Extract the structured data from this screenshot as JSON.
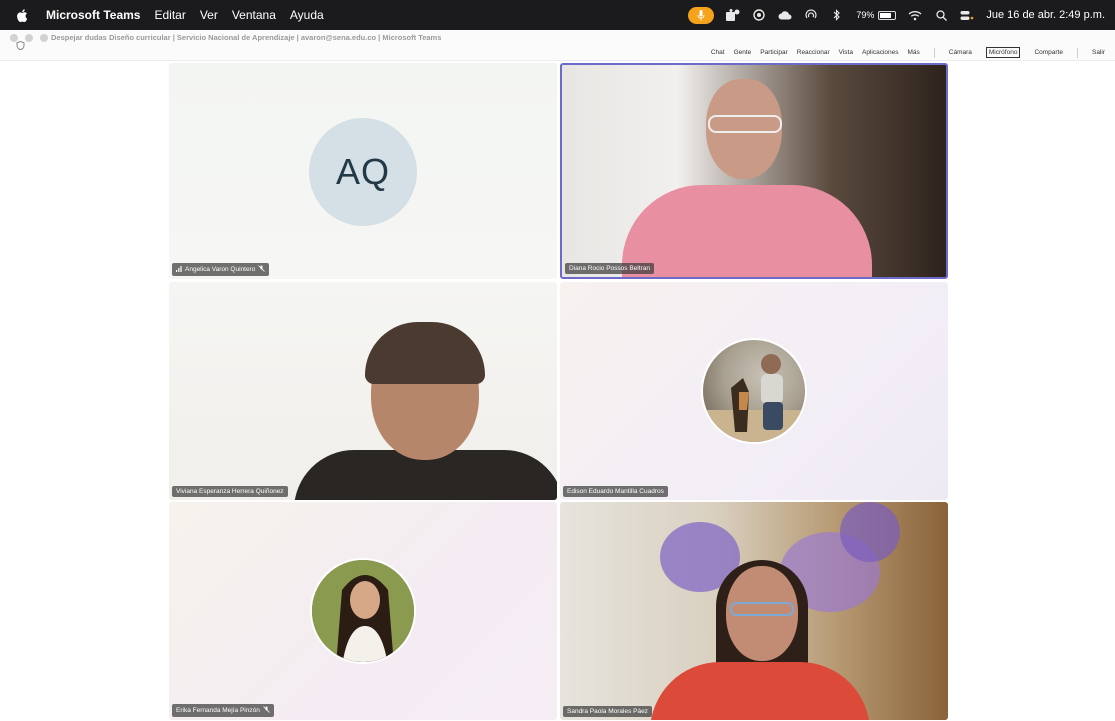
{
  "menubar": {
    "app_name": "Microsoft Teams",
    "items": [
      "Editar",
      "Ver",
      "Ventana",
      "Ayuda"
    ],
    "battery": "79%",
    "datetime": "Jue 16 de abr.  2:49 p.m."
  },
  "window": {
    "title": "Despejar dudas Diseño curricular | Servicio Nacional de Aprendizaje | avaron@sena.edu.co | Microsoft Teams"
  },
  "toolbar": {
    "chat": "Chat",
    "people": "Gente",
    "raise": "Participar",
    "react": "Reaccionar",
    "view": "Vista",
    "apps": "Aplicaciones",
    "more": "Más",
    "camera": "Cámara",
    "mic": "Micrófono",
    "share": "Comparte",
    "leave": "Salir"
  },
  "participants": [
    {
      "name": "Angelica Varon Quintero",
      "initials": "AQ",
      "muted": true
    },
    {
      "name": "Diana Rocio Possos Beltran",
      "muted": false
    },
    {
      "name": "Viviana Esperanza Herrera Quiñonez",
      "muted": false
    },
    {
      "name": "Edison Eduardo Mantilla Cuadros",
      "muted": false
    },
    {
      "name": "Erika Fernanda Mejía Pinzón",
      "muted": true
    },
    {
      "name": "Sandra Paola Morales Páez",
      "muted": false
    }
  ],
  "colors": {
    "active_speaker_border": "#6d6bc9",
    "menubar_bg": "#1b1b1d",
    "mic_pill": "#f7a21b"
  }
}
